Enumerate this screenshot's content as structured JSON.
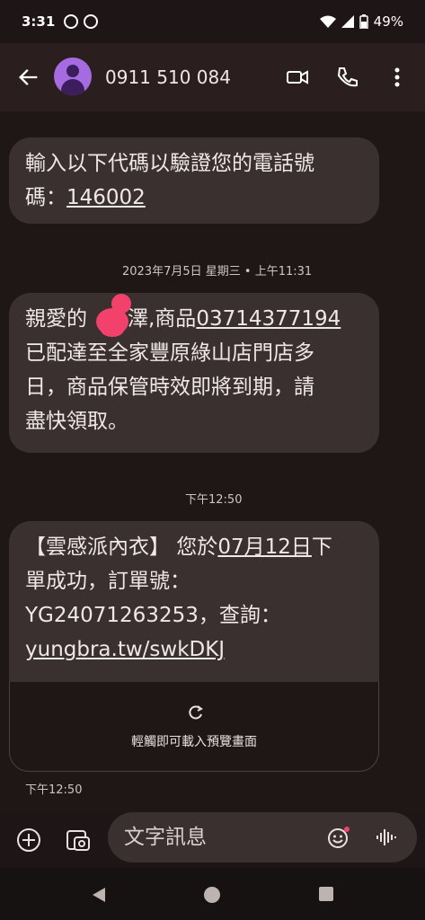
{
  "status_bar": {
    "time": "3:31",
    "battery": "49%"
  },
  "header": {
    "contact": "0911 510 084"
  },
  "messages": {
    "m1": {
      "line1": "輸入以下代碼以驗證您的電話號",
      "line2_prefix": "碼：",
      "code": "146002"
    },
    "ts1": "2023年7月5日 星期三 • 上午11:31",
    "m2": {
      "line1_prefix": "親愛的",
      "line1_name": "東澤,商品",
      "order": "03714377194",
      "line2": "已配達至全家豐原綠山店門店多",
      "line3": "日，商品保管時效即將到期，請",
      "line4": "盡快領取。"
    },
    "ts2": "下午12:50",
    "m3": {
      "line1_prefix": "【雲感派內衣】 您於",
      "date": "07月12日",
      "line1_suffix": "下",
      "line2": "單成功，訂單號：",
      "line3": "YG24071263253，查詢：",
      "url": "yungbra.tw/swkDKJ"
    },
    "preview_text": "輕觸即可載入預覽畫面",
    "ts3": "下午12:50"
  },
  "compose": {
    "placeholder": "文字訊息"
  },
  "colors": {
    "bubble": "#3a302f",
    "background": "#1e1616",
    "avatar": "#a56be0"
  },
  "icons": [
    "spotify-icon",
    "wifi-icon",
    "signal-icon",
    "battery-icon",
    "back-arrow-icon",
    "video-call-icon",
    "phone-icon",
    "more-vert-icon",
    "add-icon",
    "gallery-icon",
    "emoji-icon",
    "voice-icon",
    "reload-icon",
    "nav-back-icon",
    "nav-home-icon",
    "nav-recents-icon"
  ]
}
